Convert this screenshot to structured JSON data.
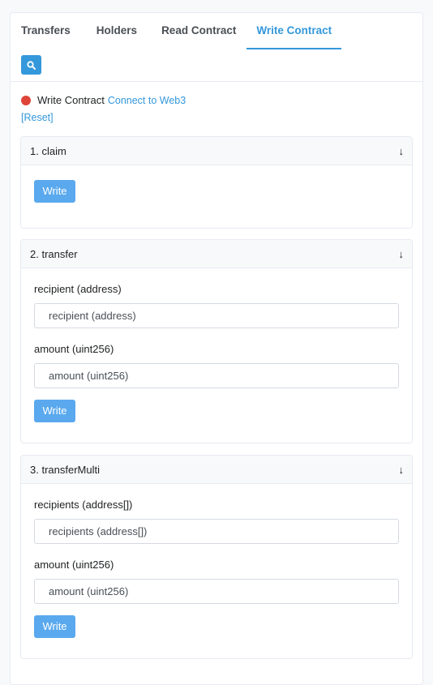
{
  "tabs": [
    {
      "label": "Transfers"
    },
    {
      "label": "Holders"
    },
    {
      "label": "Read Contract"
    },
    {
      "label": "Write Contract"
    }
  ],
  "status": {
    "label": "Write Contract",
    "connect_link": "Connect to Web3",
    "reset_link": "[Reset]",
    "dot_color": "#de4437"
  },
  "sections": [
    {
      "title": "1. claim",
      "write_label": "Write"
    },
    {
      "title": "2. transfer",
      "fields": [
        {
          "label": "recipient (address)",
          "placeholder": "recipient (address)"
        },
        {
          "label": "amount (uint256)",
          "placeholder": "amount (uint256)"
        }
      ],
      "write_label": "Write"
    },
    {
      "title": "3. transferMulti",
      "fields": [
        {
          "label": "recipients (address[])",
          "placeholder": "recipients (address[])"
        },
        {
          "label": "amount (uint256)",
          "placeholder": "amount (uint256)"
        }
      ],
      "write_label": "Write"
    }
  ],
  "icons": {
    "search": "search-icon",
    "expand": "arrow-down-icon"
  },
  "colors": {
    "accent": "#3498db",
    "button": "#5aa9ee"
  }
}
